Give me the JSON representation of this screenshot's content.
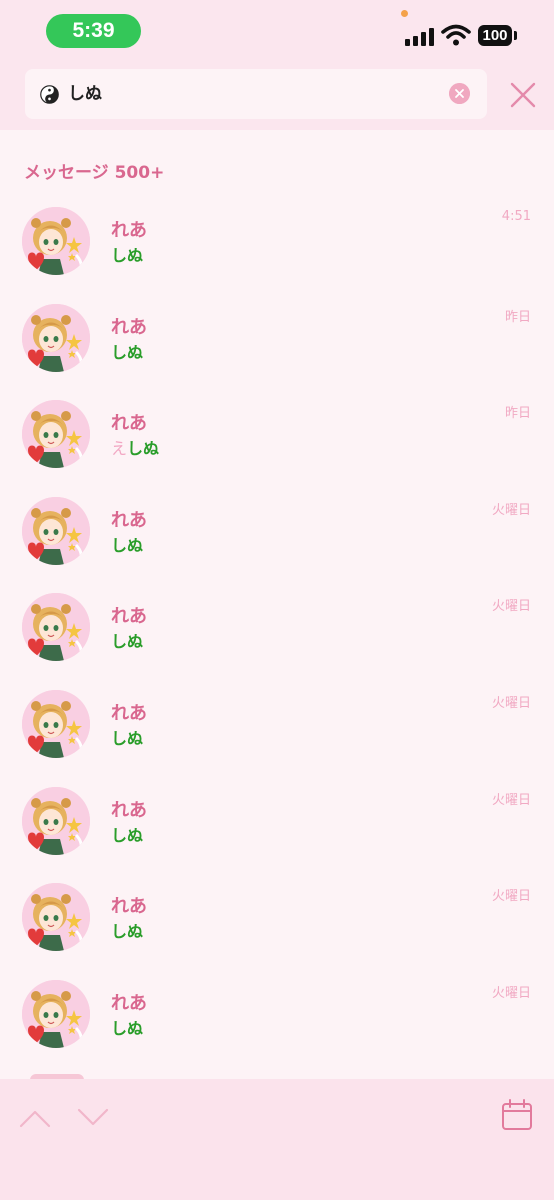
{
  "status_bar": {
    "time": "5:39",
    "battery": "100",
    "colors": {
      "time_pill": "#34c759"
    }
  },
  "search": {
    "query": "しぬ",
    "icon": "yin-yang-icon",
    "clear_icon": "clear-circle-icon",
    "close_icon": "close-icon"
  },
  "section": {
    "title": "メッセージ 500+"
  },
  "messages": [
    {
      "name": "れあ",
      "prefix": "",
      "text": "しぬ",
      "time": "4:51"
    },
    {
      "name": "れあ",
      "prefix": "",
      "text": "しぬ",
      "time": "昨日"
    },
    {
      "name": "れあ",
      "prefix": "え",
      "text": "しぬ",
      "time": "昨日"
    },
    {
      "name": "れあ",
      "prefix": "",
      "text": "しぬ",
      "time": "火曜日"
    },
    {
      "name": "れあ",
      "prefix": "",
      "text": "しぬ",
      "time": "火曜日"
    },
    {
      "name": "れあ",
      "prefix": "",
      "text": "しぬ",
      "time": "火曜日"
    },
    {
      "name": "れあ",
      "prefix": "",
      "text": "しぬ",
      "time": "火曜日"
    },
    {
      "name": "れあ",
      "prefix": "",
      "text": "しぬ",
      "time": "火曜日"
    },
    {
      "name": "れあ",
      "prefix": "",
      "text": "しぬ",
      "time": "火曜日"
    }
  ],
  "bottom_bar": {
    "up_icon": "chevron-up-icon",
    "down_icon": "chevron-down-icon",
    "calendar_icon": "calendar-icon"
  },
  "colors": {
    "accent_pink": "#d9678f",
    "match_green": "#2a9d2a",
    "background": "#fdf3f6"
  }
}
